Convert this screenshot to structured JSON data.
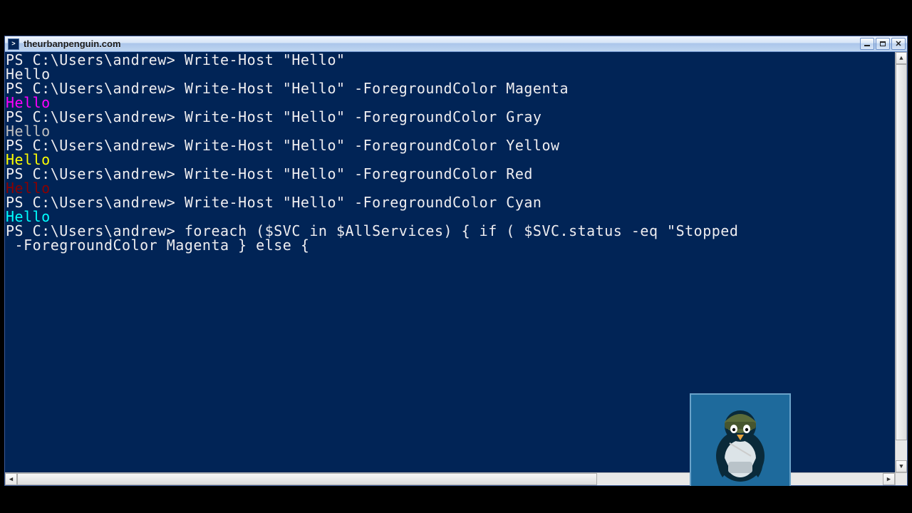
{
  "window": {
    "title": "theurbanpenguin.com"
  },
  "colors": {
    "console_bg": "#012456",
    "white": "#eeedf0",
    "magenta": "#ff00ff",
    "gray": "#c0c0c0",
    "yellow": "#ffff00",
    "red": "#ff0000",
    "darkred": "#8b0000",
    "cyan": "#00ffff"
  },
  "prompt": "PS C:\\Users\\andrew> ",
  "lines": [
    {
      "text": "PS C:\\Users\\andrew> Write-Host \"Hello\"",
      "color": "white"
    },
    {
      "text": "Hello",
      "color": "white"
    },
    {
      "text": "PS C:\\Users\\andrew> Write-Host \"Hello\" -ForegroundColor Magenta",
      "color": "white"
    },
    {
      "text": "Hello",
      "color": "magenta"
    },
    {
      "text": "PS C:\\Users\\andrew> Write-Host \"Hello\" -ForegroundColor Gray",
      "color": "white"
    },
    {
      "text": "Hello",
      "color": "gray"
    },
    {
      "text": "PS C:\\Users\\andrew> Write-Host \"Hello\" -ForegroundColor Yellow",
      "color": "white"
    },
    {
      "text": "Hello",
      "color": "yellow"
    },
    {
      "text": "PS C:\\Users\\andrew> Write-Host \"Hello\" -ForegroundColor Red",
      "color": "white"
    },
    {
      "text": "Hello",
      "color": "darkred"
    },
    {
      "text": "PS C:\\Users\\andrew> Write-Host \"Hello\" -ForegroundColor Cyan",
      "color": "white"
    },
    {
      "text": "Hello",
      "color": "cyan"
    },
    {
      "text": "PS C:\\Users\\andrew> foreach ($SVC in $AllServices) { if ( $SVC.status -eq \"Stopped",
      "color": "white"
    },
    {
      "text": " -ForegroundColor Magenta } else {",
      "color": "white"
    }
  ]
}
